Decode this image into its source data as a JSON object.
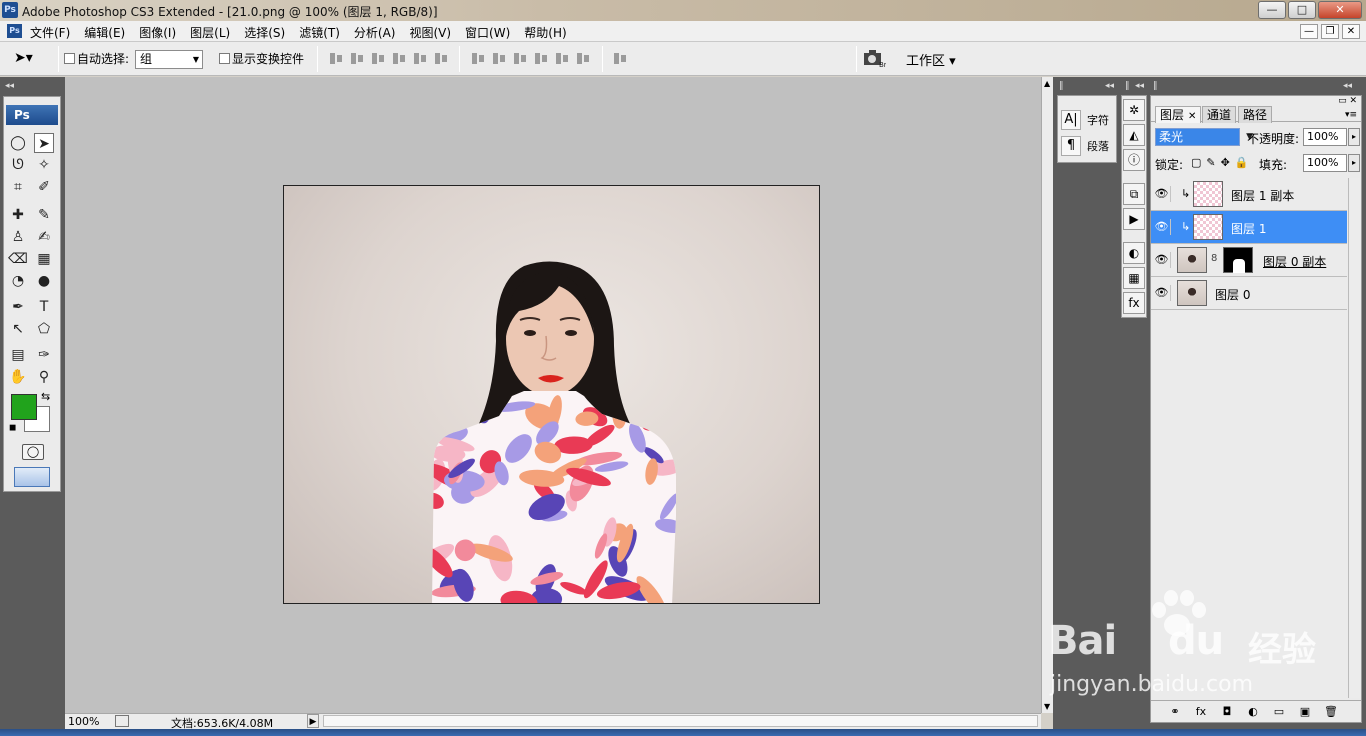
{
  "window": {
    "app_badge": "Ps",
    "title": "Adobe Photoshop CS3 Extended - [21.0.png @ 100% (图层 1, RGB/8)]",
    "minimize": "—",
    "restore": "□",
    "close": "✕"
  },
  "menu": {
    "items": [
      "文件(F)",
      "编辑(E)",
      "图像(I)",
      "图层(L)",
      "选择(S)",
      "滤镜(T)",
      "分析(A)",
      "视图(V)",
      "窗口(W)",
      "帮助(H)"
    ],
    "doc_buttons": [
      "—",
      "❐",
      "✕"
    ]
  },
  "options": {
    "auto_select_label": "自动选择:",
    "auto_select_value": "组",
    "show_transform_label": "显示变换控件",
    "workspace_label": "工作区 ▾"
  },
  "toolbox": {
    "badge": "Ps",
    "tools": [
      {
        "name": "marquee-tool",
        "glyph": "◯"
      },
      {
        "name": "move-tool",
        "glyph": "➤"
      },
      {
        "name": "lasso-tool",
        "glyph": "ᘎ"
      },
      {
        "name": "magic-wand-tool",
        "glyph": "✧"
      },
      {
        "name": "crop-tool",
        "glyph": "⌗"
      },
      {
        "name": "slice-tool",
        "glyph": "✐"
      },
      {
        "name": "healing-tool",
        "glyph": "✚"
      },
      {
        "name": "brush-tool",
        "glyph": "✎"
      },
      {
        "name": "stamp-tool",
        "glyph": "♙"
      },
      {
        "name": "history-brush-tool",
        "glyph": "✍"
      },
      {
        "name": "eraser-tool",
        "glyph": "⌫"
      },
      {
        "name": "gradient-tool",
        "glyph": "▦"
      },
      {
        "name": "blur-tool",
        "glyph": "◔"
      },
      {
        "name": "dodge-tool",
        "glyph": "●"
      },
      {
        "name": "pen-tool",
        "glyph": "✒"
      },
      {
        "name": "type-tool",
        "glyph": "T"
      },
      {
        "name": "path-select-tool",
        "glyph": "↖"
      },
      {
        "name": "shape-tool",
        "glyph": "⬠"
      },
      {
        "name": "notes-tool",
        "glyph": "▤"
      },
      {
        "name": "eyedropper-tool",
        "glyph": "✑"
      },
      {
        "name": "hand-tool",
        "glyph": "✋"
      },
      {
        "name": "zoom-tool",
        "glyph": "⚲"
      }
    ],
    "foreground_color": "#21a31c",
    "background_color": "#ffffff",
    "quickmask_glyph": "◯"
  },
  "status": {
    "zoom": "100%",
    "doc_info": "文档:653.6K/4.08M",
    "play_glyph": "▶"
  },
  "char_panel": {
    "char_icon": "A|",
    "char_label": "字符",
    "para_icon": "¶",
    "para_label": "段落"
  },
  "dock_icons": [
    "✲",
    "◭",
    "ⓘ",
    "⧉",
    "▶",
    "◐",
    "▦",
    "fx"
  ],
  "layers_panel": {
    "tabs": [
      "图层",
      "通道",
      "路径"
    ],
    "tab_close": "✕",
    "blend_mode": "柔光",
    "opacity_label": "不透明度:",
    "opacity_value": "100%",
    "lock_label": "锁定:",
    "lock_icons": [
      "▢",
      "✎",
      "✥",
      "🔒"
    ],
    "fill_label": "填充:",
    "fill_value": "100%",
    "layers": [
      {
        "name": "图层 1 副本",
        "selected": false,
        "clipped": true,
        "thumb": "pattern",
        "has_mask": false
      },
      {
        "name": "图层 1",
        "selected": true,
        "clipped": true,
        "thumb": "pattern",
        "has_mask": false
      },
      {
        "name": "图层 0 副本",
        "selected": false,
        "clipped": false,
        "thumb": "person",
        "has_mask": true
      },
      {
        "name": "图层 0",
        "selected": false,
        "clipped": false,
        "thumb": "person",
        "has_mask": false
      }
    ],
    "eye_glyph": "👁",
    "clip_glyph": "↳",
    "link_glyph": "8",
    "footer_icons": [
      "⚭",
      "fx",
      "◘",
      "◐",
      "▭",
      "▣",
      "🗑"
    ]
  },
  "watermark": {
    "brand": "Bai",
    "brand_du": "du",
    "brand_cn": "经验",
    "url": "jingyan.baidu.com"
  },
  "colors": {
    "accent_selected": "#3e8ef5",
    "canvas_bg": "#c0c0c0",
    "dock_bg": "#5b5b5b"
  }
}
